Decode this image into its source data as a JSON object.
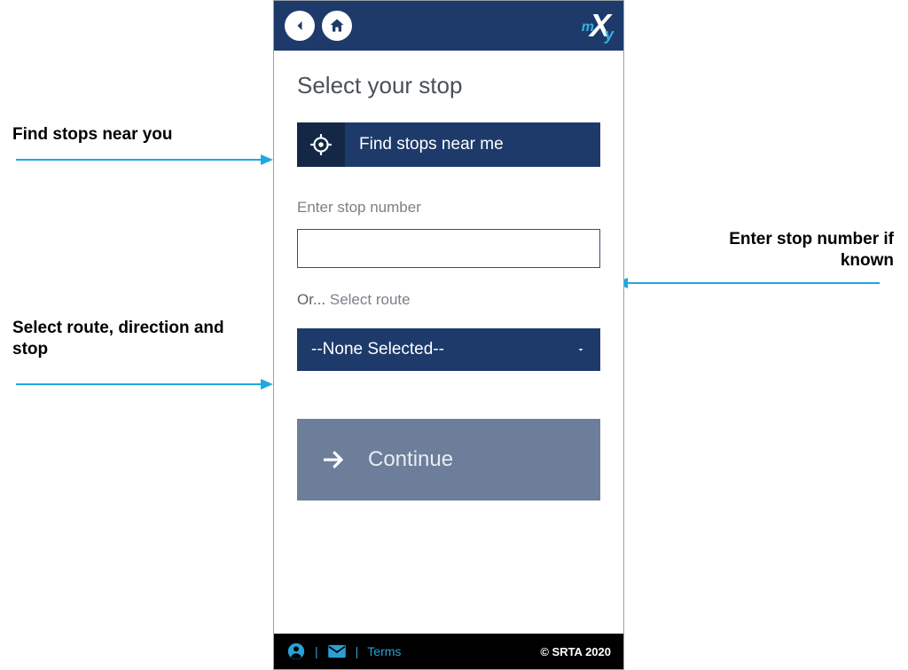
{
  "header": {
    "logo_text": "X"
  },
  "page": {
    "title": "Select your stop",
    "find_stops_label": "Find stops near me",
    "stop_number_label": "Enter stop number",
    "or_text": "Or...",
    "select_route_text": "Select route",
    "route_selected": "--None Selected--",
    "continue_label": "Continue"
  },
  "footer": {
    "terms_label": "Terms",
    "copyright": "© SRTA 2020"
  },
  "annotations": {
    "find_near": "Find stops near you",
    "enter_number": "Enter stop number if known",
    "select_route": "Select route, direction and stop"
  }
}
